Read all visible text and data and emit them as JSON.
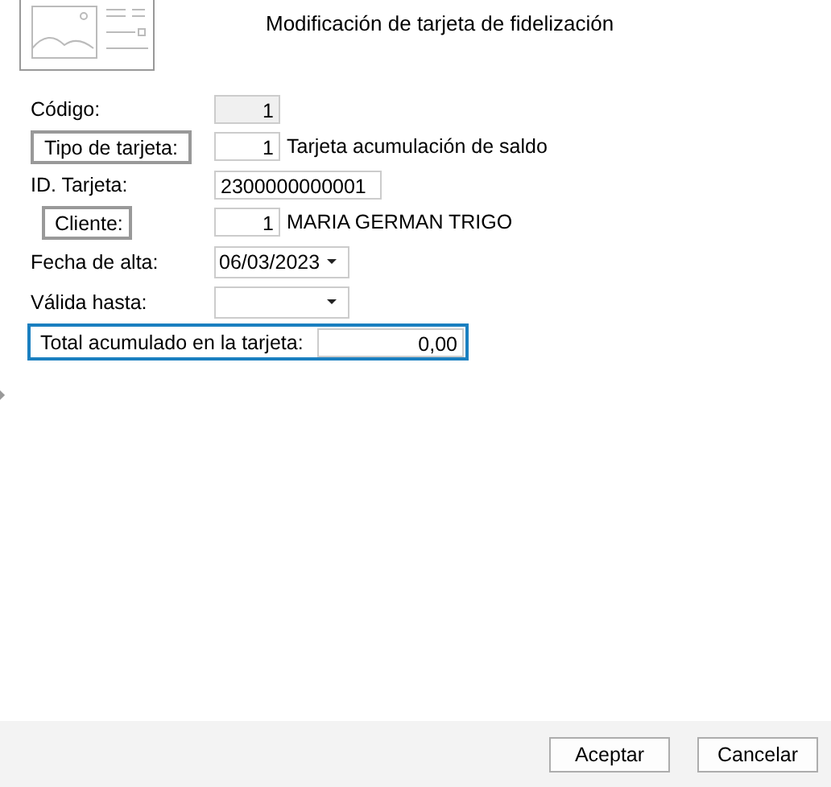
{
  "dialog": {
    "title": "Modificación de tarjeta de fidelización"
  },
  "fields": [
    {
      "kind": "number",
      "label": "Código:",
      "value": "1",
      "disabled": true
    },
    {
      "kind": "lookup",
      "label": "Tipo de tarjeta:",
      "value": "1",
      "description": "Tarjeta acumulación de saldo",
      "disabled": false
    },
    {
      "kind": "text",
      "label": "ID. Tarjeta:",
      "value": "2300000000001",
      "disabled": false
    },
    {
      "kind": "lookup",
      "label": "Cliente:",
      "value": "1",
      "description": "MARIA GERMAN TRIGO",
      "disabled": false
    },
    {
      "kind": "date",
      "label": "Fecha de alta:",
      "value": "06/03/2023",
      "disabled": false
    },
    {
      "kind": "date",
      "label": "Válida hasta:",
      "disabled": false
    },
    {
      "kind": "total",
      "label": "Total acumulado en la tarjeta:",
      "value": "0,00",
      "disabled": false
    }
  ],
  "buttons": [
    {
      "label": "Aceptar"
    },
    {
      "label": "Cancelar"
    }
  ]
}
